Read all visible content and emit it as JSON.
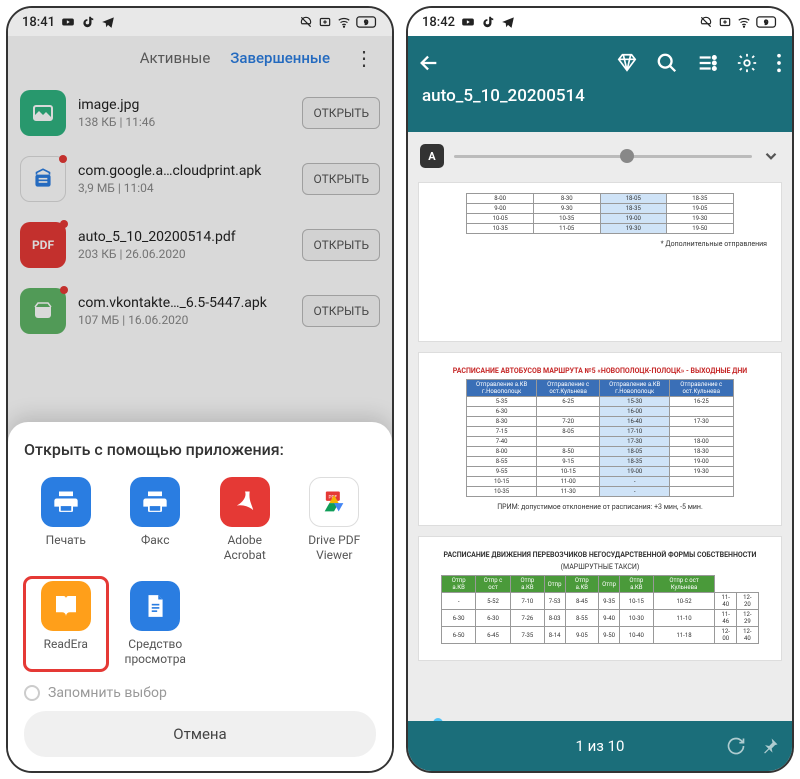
{
  "left": {
    "status_time": "18:41",
    "tabs": {
      "active": "Активные",
      "completed": "Завершенные"
    },
    "open_btn": "ОТКРЫТЬ",
    "files": [
      {
        "name": "image.jpg",
        "sub": "138 КБ | 11:46",
        "bg": "#2fb380",
        "type": "image",
        "dot": false
      },
      {
        "name": "com.google.a…cloudprint.apk",
        "sub": "3,9 МБ | 11:04",
        "bg": "#ffffff",
        "type": "apk",
        "dot": true
      },
      {
        "name": "auto_5_10_20200514.pdf",
        "sub": "203 КБ | 26.06.2020",
        "bg": "#e53935",
        "type": "pdf",
        "dot": true
      },
      {
        "name": "com.vkontakte…_6.5-5447.apk",
        "sub": "107 МБ | 16.06.2020",
        "bg": "#5fb566",
        "type": "apk",
        "dot": true
      }
    ],
    "sheet": {
      "title": "Открыть с помощью приложения:",
      "apps": [
        {
          "label": "Печать",
          "bg": "#2a7de1",
          "icon": "printer",
          "highlight": false
        },
        {
          "label": "Факс",
          "bg": "#2a7de1",
          "icon": "printer",
          "highlight": false
        },
        {
          "label": "Adobe Acrobat",
          "bg": "#e53935",
          "icon": "acrobat",
          "highlight": false
        },
        {
          "label": "Drive PDF Viewer",
          "bg": "#ffffff",
          "icon": "drive-pdf",
          "highlight": false
        },
        {
          "label": "ReadEra",
          "bg": "#ff9f1a",
          "icon": "book",
          "highlight": true
        },
        {
          "label": "Средство просмотра",
          "bg": "#2a7de1",
          "icon": "doc",
          "highlight": false
        }
      ],
      "remember": "Запомнить выбор",
      "cancel": "Отмена"
    }
  },
  "right": {
    "status_time": "18:42",
    "doc_title": "auto_5_10_20200514",
    "page_label": "1 из 10",
    "page1_note": "* Дополнительные отправления",
    "page2_caption": "РАСПИСАНИЕ АВТОБУСОВ МАРШРУТА №5 «НОВОПОЛОЦК-ПОЛОЦК» - ВЫХОДНЫЕ ДНИ",
    "page2_note": "ПРИМ: допустимое отклонение от расписания: +3 мин, -5 мин.",
    "page3_caption1": "РАСПИСАНИЕ ДВИЖЕНИЯ ПЕРЕВОЗЧИКОВ НЕГОСУДАРСТВЕННОЙ ФОРМЫ СОБСТВЕННОСТИ",
    "page3_caption2": "(МАРШРУТНЫЕ ТАКСИ)"
  }
}
